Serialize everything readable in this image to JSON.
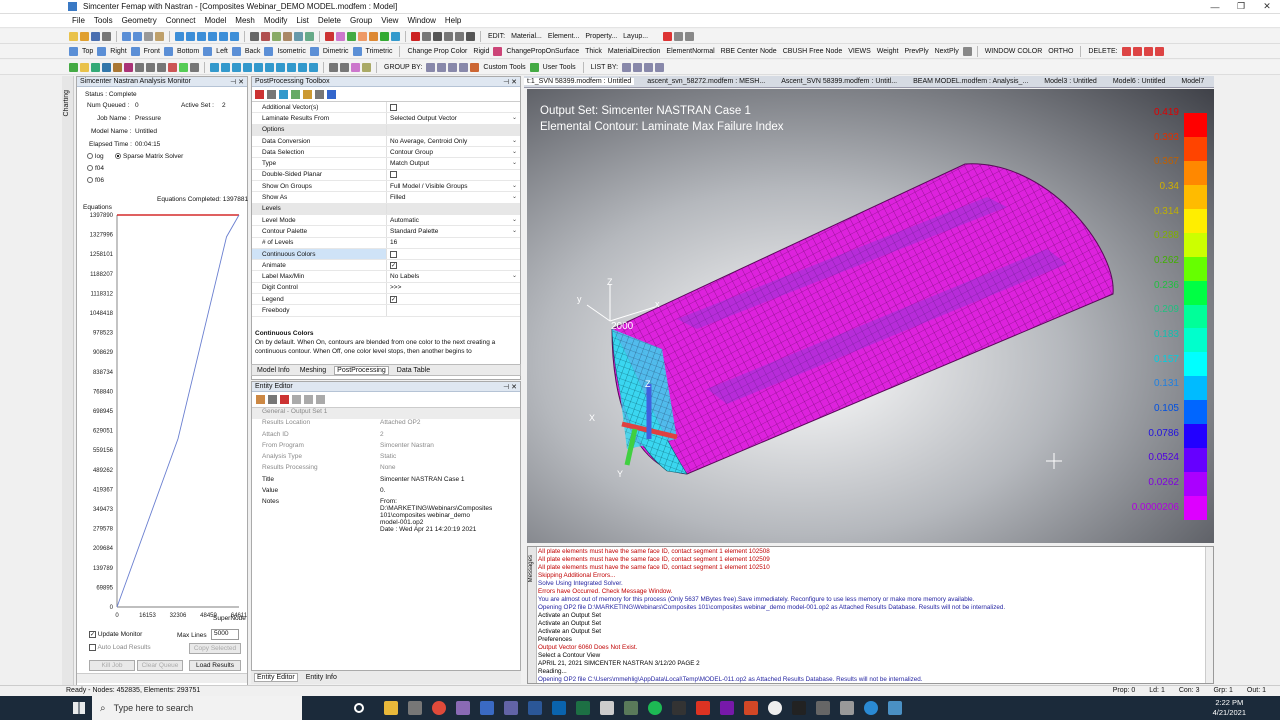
{
  "window": {
    "title": "Simcenter Femap with Nastran - [Composites Webinar_DEMO MODEL.modfem : Model]"
  },
  "menu": [
    "File",
    "Tools",
    "Geometry",
    "Connect",
    "Model",
    "Mesh",
    "Modify",
    "List",
    "Delete",
    "Group",
    "View",
    "Window",
    "Help"
  ],
  "toolbar2": {
    "labels": [
      "Top",
      "Right",
      "Front",
      "Bottom",
      "Left",
      "Back",
      "Isometric",
      "Dimetric",
      "Trimetric",
      "Change Prop Color",
      "Rigid",
      "ChangePropOnSurface",
      "Thick",
      "MaterialDirection",
      "ElementNormal",
      "RBE Center Node",
      "CBUSH Free Node",
      "VIEWS",
      "Weight",
      "PrevPly",
      "NextPly",
      "WINDOW COLOR",
      "ORTHO",
      "DELETE:"
    ]
  },
  "toolbar1": {
    "labels": [
      "EDIT:",
      "Material...",
      "Element...",
      "Property...",
      "Layup..."
    ]
  },
  "toolbar3": {
    "labels": [
      "GROUP BY:",
      "Custom Tools",
      "User Tools",
      "LIST BY:"
    ]
  },
  "left_strip": {
    "label": "Charting"
  },
  "monitor": {
    "title": "Simcenter Nastran Analysis Monitor",
    "status": "Status : Complete",
    "num_queued_label": "Num Queued :",
    "num_queued": "0",
    "active_set_label": "Active Set :",
    "active_set": "2",
    "job_name_label": "Job Name :",
    "job_name": "Pressure",
    "model_name_label": "Model Name :",
    "model_name": "Untitled",
    "elapsed_label": "Elapsed Time :",
    "elapsed": "00:04:15",
    "radios": [
      "log",
      "f04",
      "f06"
    ],
    "solver_label": "Sparse Matrix Solver",
    "equations_completed": "Equations Completed: 1397881",
    "equations_label": "Equations",
    "supernode_label": "SuperNode",
    "update_monitor": "Update Monitor",
    "auto_load": "Auto Load Results",
    "max_lines_label": "Max Lines",
    "max_lines": "5000",
    "copy_selected": "Copy Selected",
    "kill_job": "Kill Job",
    "clear_queue": "Clear Queue",
    "load_results": "Load Results"
  },
  "chart_data": {
    "type": "line",
    "title": "",
    "xlabel": "SuperNode",
    "ylabel": "Equations",
    "x_ticks": [
      "0",
      "16153",
      "32306",
      "48459",
      "64611"
    ],
    "y_ticks": [
      "0",
      "69895",
      "139789",
      "209684",
      "279578",
      "349473",
      "419367",
      "489262",
      "559156",
      "629051",
      "698945",
      "768840",
      "838734",
      "908629",
      "978523",
      "1048418",
      "1118312",
      "1188207",
      "1258101",
      "1327996",
      "1397890"
    ],
    "xlim": [
      0,
      64611
    ],
    "ylim": [
      0,
      1397890
    ],
    "series": [
      {
        "x": [
          0,
          32306,
          58000,
          64611
        ],
        "y": [
          0,
          600000,
          1320000,
          1397881
        ]
      }
    ],
    "reference_line": 1397890
  },
  "ppt": {
    "title": "PostProcessing Toolbox",
    "rows": [
      {
        "k": "Additional Vector(s)",
        "v": "",
        "cb": true
      },
      {
        "k": "Laminate Results From",
        "v": "Selected Output Vector",
        "dd": true
      },
      {
        "k": "Options",
        "v": "",
        "sec": true
      },
      {
        "k": "Data Conversion",
        "v": "No Average, Centroid Only",
        "dd": true
      },
      {
        "k": "Data Selection",
        "v": "Contour Group",
        "dd": true
      },
      {
        "k": "Type",
        "v": "Match Output",
        "dd": true
      },
      {
        "k": "Double-Sided Planar",
        "v": "",
        "cb": true
      },
      {
        "k": "Show On Groups",
        "v": "Full Model / Visible Groups",
        "dd": true
      },
      {
        "k": "Show As",
        "v": "Filled",
        "dd": true
      },
      {
        "k": "Levels",
        "v": "",
        "sec": true
      },
      {
        "k": "Level Mode",
        "v": "Automatic",
        "dd": true
      },
      {
        "k": "Contour Palette",
        "v": "Standard Palette",
        "dd": true
      },
      {
        "k": "# of Levels",
        "v": "16"
      },
      {
        "k": "Continuous Colors",
        "v": "",
        "cb": true,
        "sel": true
      },
      {
        "k": "Animate",
        "v": "",
        "cb": true,
        "checked": true
      },
      {
        "k": "Label Max/Min",
        "v": "No Labels",
        "dd": true
      },
      {
        "k": "Digit Control",
        "v": ">>>"
      },
      {
        "k": "Legend",
        "v": "",
        "cb": true,
        "checked": true
      },
      {
        "k": "Freebody",
        "v": ""
      }
    ],
    "help_title": "Continuous Colors",
    "help_text": "On by default. When On, contours are blended from one color to the next creating a continuous contour. When Off, one color level stops, then another begins to",
    "tabs": [
      "Model Info",
      "Meshing",
      "PostProcessing",
      "Data Table"
    ]
  },
  "ee": {
    "title": "Entity Editor",
    "rows": [
      {
        "k": "General - Output Set 1",
        "v": "",
        "sec": true
      },
      {
        "k": "Results Location",
        "v": "Attached OP2",
        "grey": true
      },
      {
        "k": "Attach ID",
        "v": "2",
        "grey": true
      },
      {
        "k": "From Program",
        "v": "Simcenter Nastran",
        "grey": true
      },
      {
        "k": "Analysis Type",
        "v": "Static",
        "grey": true
      },
      {
        "k": "Results Processing",
        "v": "None",
        "grey": true
      },
      {
        "k": "Title",
        "v": "Simcenter NASTRAN Case 1"
      },
      {
        "k": "Value",
        "v": "0."
      },
      {
        "k": "Notes",
        "v": "From:\nD:\\MARKETING\\Webinars\\Composites\n101\\composites webinar_demo\nmodel-001.op2\nDate : Wed Apr 21 14:20:19 2021"
      }
    ],
    "tabs": [
      "Entity Editor",
      "Entity Info"
    ]
  },
  "doctabs": [
    "t:1_SVN 58399.modfem : Untitled",
    "ascent_svn_58272.modfem : MESH...",
    "Ascent_SVN 58399.modfem : Untitl...",
    "BEAM MODEL.modfem : Analysis_...",
    "Model3 : Untitled",
    "Model6 : Untitled",
    "Model7"
  ],
  "view": {
    "line1": "Output Set: Simcenter NASTRAN Case 1",
    "line2": "Elemental Contour: Laminate Max Failure Index",
    "axis_label_2000": "2000"
  },
  "legend": {
    "values": [
      "0.419",
      "0.393",
      "0.367",
      "0.34",
      "0.314",
      "0.288",
      "0.262",
      "0.236",
      "0.209",
      "0.183",
      "0.157",
      "0.131",
      "0.105",
      "0.0786",
      "0.0524",
      "0.0262",
      "0.0000206"
    ],
    "colors": [
      "#ff0000",
      "#ff4400",
      "#ff8800",
      "#ffbb00",
      "#ffee00",
      "#ccff00",
      "#66ff00",
      "#00ff44",
      "#00ff99",
      "#00ffcc",
      "#00ffff",
      "#00bbff",
      "#0066ff",
      "#2200ff",
      "#6600ff",
      "#aa00ff",
      "#dd00ff"
    ],
    "label_colors": [
      "#e00000",
      "#e03000",
      "#c06000",
      "#d0b000",
      "#c0b000",
      "#80b000",
      "#40b000",
      "#20c040",
      "#20c080",
      "#10c0b0",
      "#00d0e0",
      "#2080e0",
      "#0050e0",
      "#2010e0",
      "#5000e0",
      "#8000e0",
      "#b000e0"
    ]
  },
  "messages": {
    "side_label": "Messages",
    "lines": [
      {
        "t": "All plate elements must have the same face ID, contact segment 1 element 102508",
        "c": "mred"
      },
      {
        "t": "All plate elements must have the same face ID, contact segment 1 element 102509",
        "c": "mred"
      },
      {
        "t": "All plate elements must have the same face ID, contact segment 1 element 102510",
        "c": "mred"
      },
      {
        "t": "Skipping Additional Errors...",
        "c": "mred"
      },
      {
        "t": "Solve Using Integrated Solver.",
        "c": "mblu"
      },
      {
        "t": "Errors have Occurred. Check Message Window.",
        "c": "mred"
      },
      {
        "t": "You are almost out of memory for this process (Only 5637 MBytes free).Save immediately. Reconfigure to use less memory or make more memory available.",
        "c": "mblu"
      },
      {
        "t": "Opening OP2 file D:\\MARKETING\\Webinars\\Composites 101\\composites webinar_demo model-001.op2 as Attached Results Database. Results will not be internalized.",
        "c": "mblu"
      },
      {
        "t": "Activate an Output Set",
        "c": "mblk"
      },
      {
        "t": "Activate an Output Set",
        "c": "mblk"
      },
      {
        "t": "Activate an Output Set",
        "c": "mblk"
      },
      {
        "t": "Preferences",
        "c": "mblk"
      },
      {
        "t": "Output Vector 6060 Does Not Exist.",
        "c": "mred"
      },
      {
        "t": "Select a Contour View",
        "c": "mblk"
      },
      {
        "t": "APRIL 21, 2021  SIMCENTER NASTRAN  3/12/20   PAGE    2",
        "c": "mblk"
      },
      {
        "t": "Reading...",
        "c": "mblk"
      },
      {
        "t": "Opening OP2 file C:\\Users\\mmehlig\\AppData\\Local\\Temp\\MODEL-011.op2 as Attached Results Database. Results will not be internalized.",
        "c": "mblu"
      }
    ]
  },
  "status": {
    "left": "Ready - Nodes: 452835,  Elements: 293751",
    "prop": "Prop: 0",
    "ld": "Ld: 1",
    "con": "Con: 3",
    "grp": "Grp: 1",
    "out": "Out: 1"
  },
  "taskbar": {
    "search": "Type here to search",
    "time": "2:22 PM",
    "date": "4/21/2021"
  }
}
